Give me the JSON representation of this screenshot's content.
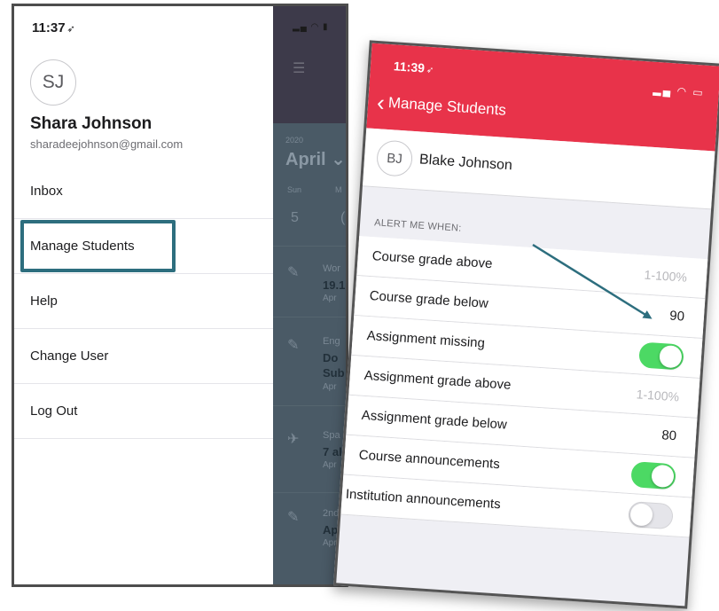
{
  "left_phone": {
    "status_time": "11:37",
    "user": {
      "initials": "SJ",
      "name": "Shara Johnson",
      "email": "sharadeejohnson@gmail.com"
    },
    "menu": [
      {
        "label": "Inbox"
      },
      {
        "label": "Manage Students",
        "highlighted": true
      },
      {
        "label": "Help"
      },
      {
        "label": "Change User"
      },
      {
        "label": "Log Out"
      }
    ],
    "backdrop": {
      "year": "2020",
      "month": "April",
      "weekdays": [
        "Sun",
        "M"
      ],
      "days": [
        "5",
        "("
      ],
      "items": [
        {
          "line1": "Wor",
          "line2": "19.1",
          "line3": "Apr"
        },
        {
          "line1": "Eng",
          "line2": "Do",
          "line2b": "Sub",
          "line3": "Apr"
        },
        {
          "line1": "Spa",
          "line2": "7 al",
          "line3": "Apr"
        },
        {
          "line1": "2nd",
          "line2": "Apr",
          "line3": "Apr"
        }
      ]
    }
  },
  "right_phone": {
    "status_time": "11:39",
    "nav": {
      "back_label": "Manage Students",
      "bar_color": "#e8334a"
    },
    "student": {
      "initials": "BJ",
      "name": "Blake Johnson"
    },
    "section_header": "ALERT ME WHEN:",
    "settings": [
      {
        "label": "Course grade above",
        "type": "number",
        "value": "",
        "placeholder": "1-100%"
      },
      {
        "label": "Course grade below",
        "type": "number",
        "value": "90",
        "placeholder": ""
      },
      {
        "label": "Assignment missing",
        "type": "toggle",
        "on": true
      },
      {
        "label": "Assignment grade above",
        "type": "number",
        "value": "",
        "placeholder": "1-100%"
      },
      {
        "label": "Assignment grade below",
        "type": "number",
        "value": "80",
        "placeholder": ""
      },
      {
        "label": "Course announcements",
        "type": "toggle",
        "on": true
      },
      {
        "label": "Institution announcements",
        "type": "toggle",
        "on": false
      }
    ],
    "toggle_on_color": "#4cd964"
  },
  "annotation": {
    "highlight_color": "#2d6e7e",
    "arrow_color": "#2d6e7e"
  }
}
